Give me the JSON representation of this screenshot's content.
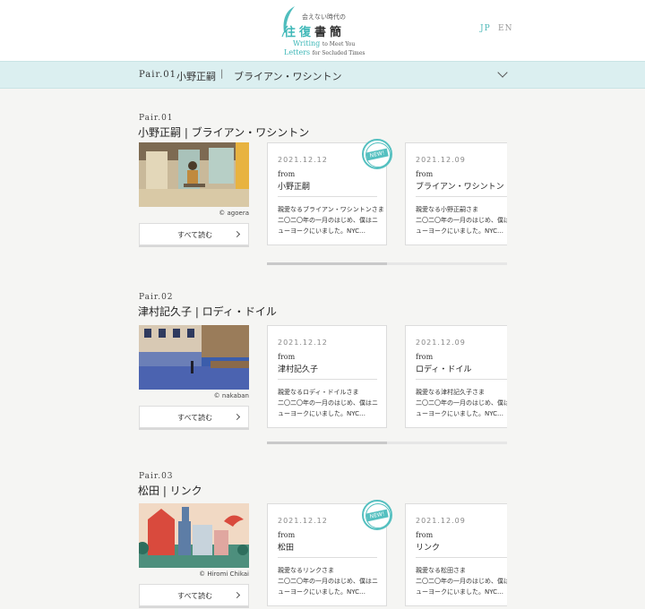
{
  "header": {
    "logo_small": "会えない時代の",
    "logo_title_1": "往復",
    "logo_title_2": "書簡",
    "logo_en1": "Writing",
    "logo_en1_small": "to Meet You",
    "logo_en2": "Letters",
    "logo_en2_small": "for Secluded Times",
    "lang_jp": "JP",
    "lang_en": "EN"
  },
  "navbar": {
    "pair": "Pair.01",
    "name1": "小野正嗣",
    "separator": "|",
    "name2": "ブライアン・ワシントン"
  },
  "read_all_label": "すべて読む",
  "new_badge": "NEW!",
  "pairs": [
    {
      "no": "Pair.01",
      "title": "小野正嗣 | ブライアン・ワシントン",
      "credit": "© agoera",
      "letters": [
        {
          "date": "2021.12.12",
          "from": "from",
          "sender": "小野正嗣",
          "excerpt": "親愛なるブライアン・ワシントンさま\n二〇二〇年の一月のはじめ、僕はニ\nューヨークにいました。NYC…",
          "new": true
        },
        {
          "date": "2021.12.09",
          "from": "from",
          "sender": "ブライアン・ワシントン",
          "excerpt": "親愛なる小野正嗣さま\n二〇二〇年の一月のはじめ、僕はニ\nューヨークにいました。NYC…",
          "new": false
        }
      ]
    },
    {
      "no": "Pair.02",
      "title": "津村記久子 | ロディ・ドイル",
      "credit": "© nakaban",
      "letters": [
        {
          "date": "2021.12.12",
          "from": "from",
          "sender": "津村記久子",
          "excerpt": "親愛なるロディ・ドイルさま\n二〇二〇年の一月のはじめ、僕はニ\nューヨークにいました。NYC…",
          "new": false
        },
        {
          "date": "2021.12.09",
          "from": "from",
          "sender": "ロディ・ドイル",
          "excerpt": "親愛なる津村記久子さま\n二〇二〇年の一月のはじめ、僕はニ\nューヨークにいました。NYC…",
          "new": false
        }
      ]
    },
    {
      "no": "Pair.03",
      "title": "松田 | リンク",
      "credit": "© Hiromi Chikai",
      "letters": [
        {
          "date": "2021.12.12",
          "from": "from",
          "sender": "松田",
          "excerpt": "親愛なるリンクさま\n二〇二〇年の一月のはじめ、僕はニ\nューヨークにいました。NYC…",
          "new": true
        },
        {
          "date": "2021.12.09",
          "from": "from",
          "sender": "リンク",
          "excerpt": "親愛なる松田さま\n二〇二〇年の一月のはじめ、僕はニ\nューヨークにいました。NYC…",
          "new": false
        }
      ]
    }
  ]
}
